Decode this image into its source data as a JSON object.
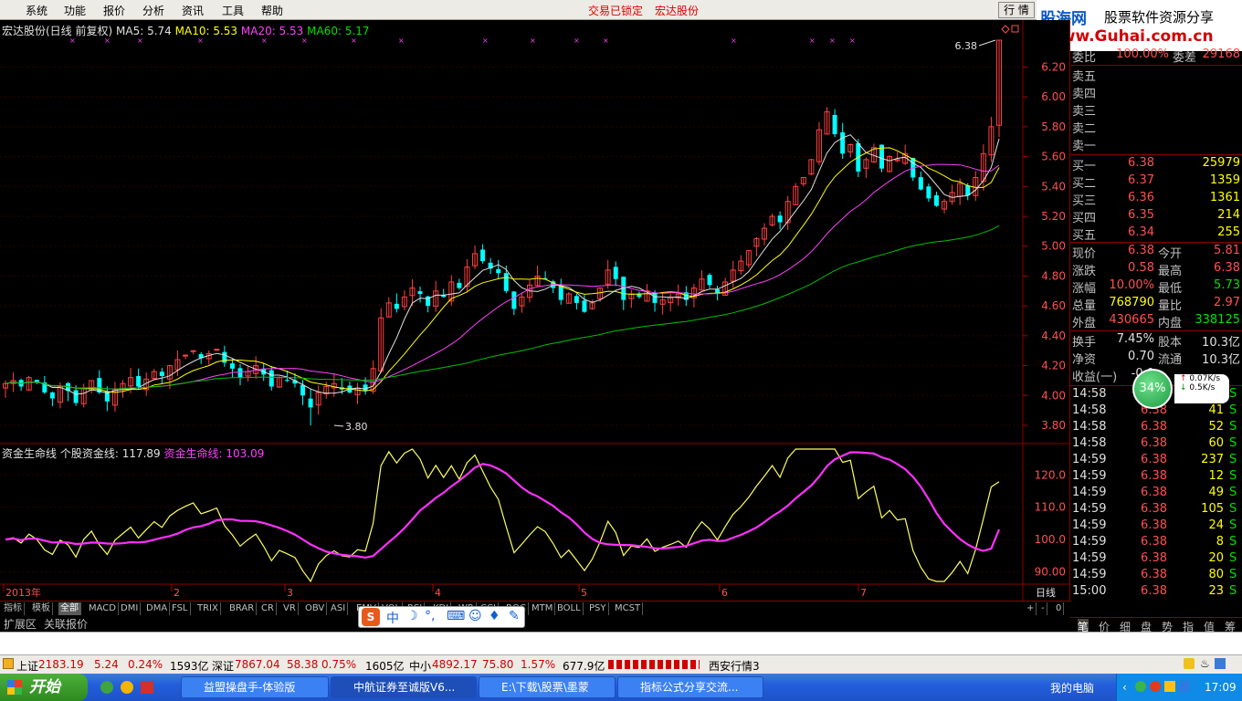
{
  "menu": [
    "系统",
    "功能",
    "报价",
    "分析",
    "资讯",
    "工具",
    "帮助"
  ],
  "lock_text": "交易已锁定",
  "stock_header": "宏达股份",
  "hq_button": "行 情",
  "logo": {
    "line1": "股海网",
    "line1b": "股票软件资源分享",
    "line2": "Www.Guhai.com.cn"
  },
  "chart": {
    "title": "宏达股份(日线 前复权)",
    "ma5": "MA5: 5.74",
    "ma10": "MA10: 5.53",
    "ma20": "MA20: 5.53",
    "ma60": "MA60: 5.17",
    "price_ticks": [
      "6.20",
      "6.00",
      "5.80",
      "5.60",
      "5.40",
      "5.20",
      "5.00",
      "4.80",
      "4.60",
      "4.40",
      "4.20",
      "4.00",
      "3.80"
    ],
    "high_label": "6.38",
    "low_label": "3.80",
    "indicator_title": "资金生命线",
    "indicator_v1": "个股资金线: 117.89",
    "indicator_v2": "资金生命线: 103.09",
    "ind_ticks": [
      "120.0",
      "110.0",
      "100.0",
      "90.00"
    ],
    "x_labels": [
      "2013年",
      "2",
      "3",
      "4",
      "5",
      "6",
      "7"
    ],
    "period": "日线"
  },
  "chart_data": [
    {
      "type": "candlestick",
      "title": "宏达股份(日线 前复权)",
      "ylim": [
        3.7,
        6.45
      ],
      "close": [
        4.08,
        4.1,
        4.06,
        4.12,
        4.09,
        4.02,
        3.98,
        4.06,
        4.03,
        3.95,
        4.05,
        4.1,
        4.02,
        3.96,
        4.04,
        4.08,
        4.12,
        4.06,
        4.11,
        4.16,
        4.13,
        4.2,
        4.24,
        4.27,
        4.3,
        4.25,
        4.28,
        4.31,
        4.22,
        4.18,
        4.12,
        4.16,
        4.2,
        4.14,
        4.06,
        4.12,
        4.1,
        4.08,
        4.0,
        3.92,
        4.02,
        4.06,
        4.08,
        4.04,
        4.02,
        4.05,
        4.03,
        4.18,
        4.52,
        4.62,
        4.58,
        4.66,
        4.72,
        4.68,
        4.6,
        4.7,
        4.66,
        4.76,
        4.72,
        4.86,
        4.95,
        4.9,
        4.85,
        4.82,
        4.7,
        4.58,
        4.66,
        4.74,
        4.8,
        4.78,
        4.72,
        4.64,
        4.68,
        4.62,
        4.56,
        4.62,
        4.72,
        4.84,
        4.78,
        4.64,
        4.68,
        4.66,
        4.7,
        4.62,
        4.64,
        4.66,
        4.68,
        4.64,
        4.72,
        4.78,
        4.74,
        4.68,
        4.76,
        4.84,
        4.9,
        4.97,
        5.05,
        5.12,
        5.2,
        5.16,
        5.3,
        5.4,
        5.46,
        5.58,
        5.78,
        5.9,
        5.75,
        5.62,
        5.68,
        5.5,
        5.58,
        5.66,
        5.52,
        5.6,
        5.58,
        5.62,
        5.46,
        5.38,
        5.32,
        5.27,
        5.3,
        5.36,
        5.42,
        5.34,
        5.46,
        5.62,
        5.8,
        6.38
      ]
    },
    {
      "type": "line",
      "title": "资金生命线",
      "series": [
        {
          "name": "个股资金线",
          "y_last": 117.89
        },
        {
          "name": "资金生命线",
          "y_last": 103.09
        }
      ],
      "ylim": [
        87,
        128
      ]
    }
  ],
  "right": {
    "wei": {
      "label": "委比",
      "val": "100.00%",
      "label2": "委差",
      "val2": "29168"
    },
    "sell": [
      {
        "label": "卖五"
      },
      {
        "label": "卖四"
      },
      {
        "label": "卖三"
      },
      {
        "label": "卖二"
      },
      {
        "label": "卖一"
      }
    ],
    "buy": [
      {
        "label": "买一",
        "price": "6.38",
        "vol": "25979"
      },
      {
        "label": "买二",
        "price": "6.37",
        "vol": "1359"
      },
      {
        "label": "买三",
        "price": "6.36",
        "vol": "1361"
      },
      {
        "label": "买四",
        "price": "6.35",
        "vol": "214"
      },
      {
        "label": "买五",
        "price": "6.34",
        "vol": "255"
      }
    ],
    "quote": [
      {
        "l1": "现价",
        "v1": "6.38",
        "l2": "今开",
        "v2": "5.81"
      },
      {
        "l1": "涨跌",
        "v1": "0.58",
        "l2": "最高",
        "v2": "6.38"
      },
      {
        "l1": "涨幅",
        "v1": "10.00%",
        "l2": "最低",
        "v2": "5.73"
      },
      {
        "l1": "总量",
        "v1": "768790",
        "l2": "量比",
        "v2": "2.97"
      },
      {
        "l1": "外盘",
        "v1": "430665",
        "l2": "内盘",
        "v2": "338125"
      }
    ],
    "fund": [
      {
        "l1": "换手",
        "v1": "7.45%",
        "l2": "股本",
        "v2": "10.3亿"
      },
      {
        "l1": "净资",
        "v1": "0.70",
        "l2": "流通",
        "v2": "10.3亿"
      },
      {
        "l1": "收益(一)",
        "v1": "-0.0",
        "l2": "",
        "v2": ""
      }
    ],
    "ticks": [
      {
        "t": "14:58",
        "p": "6.38",
        "v": "",
        "s": "S"
      },
      {
        "t": "14:58",
        "p": "6.38",
        "v": "41",
        "s": "S"
      },
      {
        "t": "14:58",
        "p": "6.38",
        "v": "52",
        "s": "S"
      },
      {
        "t": "14:58",
        "p": "6.38",
        "v": "60",
        "s": "S"
      },
      {
        "t": "14:59",
        "p": "6.38",
        "v": "237",
        "s": "S"
      },
      {
        "t": "14:59",
        "p": "6.38",
        "v": "12",
        "s": "S"
      },
      {
        "t": "14:59",
        "p": "6.38",
        "v": "49",
        "s": "S"
      },
      {
        "t": "14:59",
        "p": "6.38",
        "v": "105",
        "s": "S"
      },
      {
        "t": "14:59",
        "p": "6.38",
        "v": "24",
        "s": "S"
      },
      {
        "t": "14:59",
        "p": "6.38",
        "v": "8",
        "s": "S"
      },
      {
        "t": "14:59",
        "p": "6.38",
        "v": "20",
        "s": "S"
      },
      {
        "t": "14:59",
        "p": "6.38",
        "v": "80",
        "s": "S"
      },
      {
        "t": "15:00",
        "p": "6.38",
        "v": "23",
        "s": "S"
      }
    ],
    "bottom_tabs": [
      "笔",
      "价",
      "细",
      "盘",
      "势",
      "指",
      "值",
      "筹"
    ]
  },
  "speed": {
    "pct": "34%",
    "up": "0.07K/s",
    "down": "0.5K/s"
  },
  "tabs": [
    "指标",
    "模板",
    "全部",
    "MACD",
    "DMI",
    "DMA",
    "FSL",
    "TRIX",
    "BRAR",
    "CR",
    "VR",
    "OBV",
    "ASI",
    "EMV",
    "VOL",
    "RSI",
    "KDJ",
    "WR",
    "CCI",
    "ROC",
    "MTM",
    "BOLL",
    "PSY",
    "MCST"
  ],
  "tab_controls": [
    "+",
    "-",
    "0"
  ],
  "sub_tabs": [
    "扩展区",
    "关联报价"
  ],
  "status": {
    "sh_label": "上证",
    "sh_val": "2183.19",
    "sh_chg": "5.24",
    "sh_pct": "0.24%",
    "sh_amt": "1593亿",
    "sz_label": "深证",
    "sz_val": "7867.04",
    "sz_chg": "58.38",
    "sz_pct": "0.75%",
    "sz_amt": "1605亿",
    "zx_label": "中小",
    "zx_val": "4892.17",
    "zx_chg": "75.80",
    "zx_pct": "1.57%",
    "zx_amt": "677.9亿",
    "server": "西安行情3"
  },
  "taskbar": {
    "start": "开始",
    "tasks": [
      "益盟操盘手-体验版",
      "中航证券至诚版V6...",
      "E:\\下载\\股票\\墨蒙",
      "指标公式分享交流..."
    ],
    "computer": "我的电脑",
    "clock": "17:09"
  }
}
